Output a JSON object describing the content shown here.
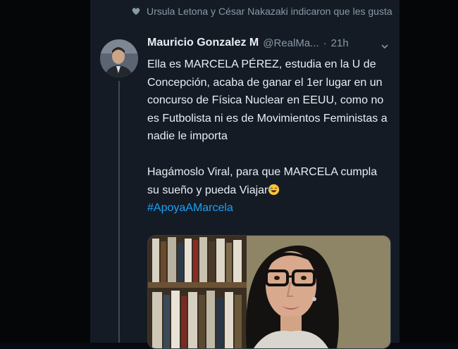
{
  "activity": {
    "icon": "heart-icon",
    "text": "Ursula Letona y César Nakazaki indicaron que les gusta"
  },
  "tweet": {
    "author_name": "Mauricio Gonzalez M",
    "handle": "@RealMa...",
    "separator": "·",
    "time": "21h",
    "body": "Ella es MARCELA PÉREZ, estudia en la U de Concepción, acaba de ganar el 1er lugar en un concurso de Física Nuclear en EEUU, como no es Futbolista ni es de Movimientos Feministas a nadie le importa\n\nHagámoslo Viral, para que MARCELA cumpla su sueño y pueda Viajar",
    "emoji": "laughing-emoji",
    "hashtag": "#ApoyaAMarcela"
  },
  "colors": {
    "background": "#141b25",
    "text": "#e9eef2",
    "muted": "#8899a6",
    "link": "#1da1f2"
  }
}
